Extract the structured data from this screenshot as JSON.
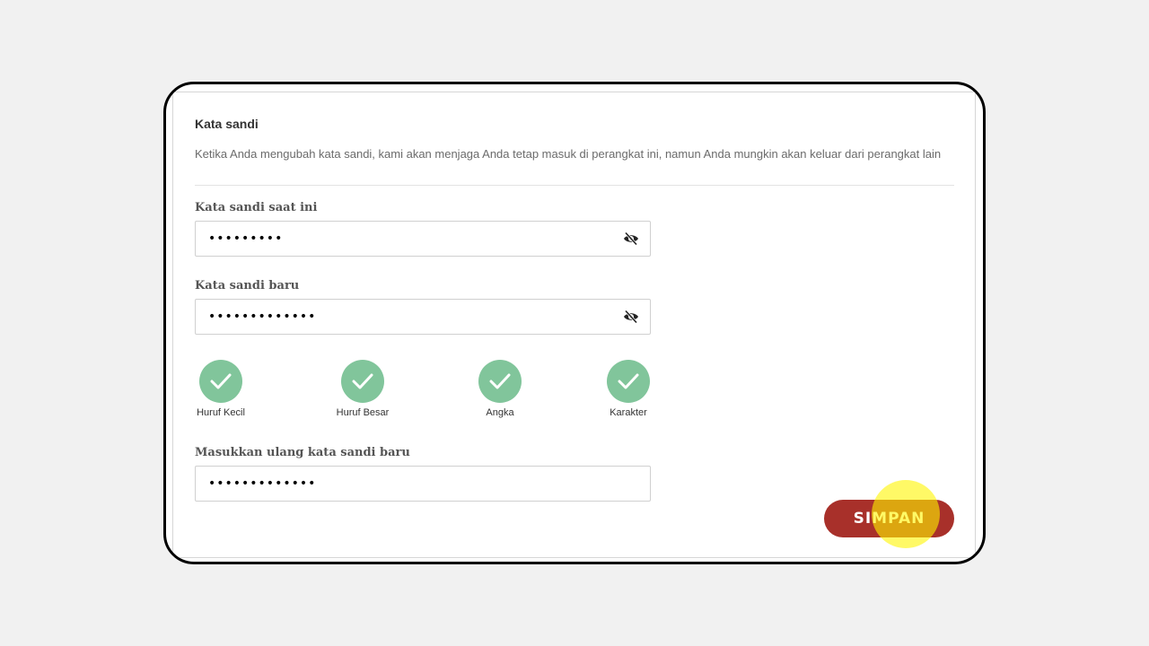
{
  "section": {
    "title": "Kata sandi",
    "description": "Ketika Anda mengubah kata sandi, kami akan menjaga Anda tetap masuk di perangkat ini, namun Anda mungkin akan keluar dari perangkat lain"
  },
  "fields": {
    "current": {
      "label": "Kata sandi saat ini",
      "value": "•••••••••"
    },
    "new": {
      "label": "Kata sandi baru",
      "value": "•••••••••••••"
    },
    "confirm": {
      "label": "Masukkan ulang kata sandi baru",
      "value": "•••••••••••••"
    }
  },
  "requirements": [
    {
      "label": "Huruf Kecil",
      "met": true
    },
    {
      "label": "Huruf Besar",
      "met": true
    },
    {
      "label": "Angka",
      "met": true
    },
    {
      "label": "Karakter",
      "met": true
    }
  ],
  "actions": {
    "save_label": "SIMPAN"
  },
  "colors": {
    "accent": "#a8302a",
    "success": "#81c59b",
    "highlight": "#fff500"
  },
  "icons": {
    "visibility_toggle": "eye-slash-icon",
    "requirement_met": "check-icon"
  }
}
